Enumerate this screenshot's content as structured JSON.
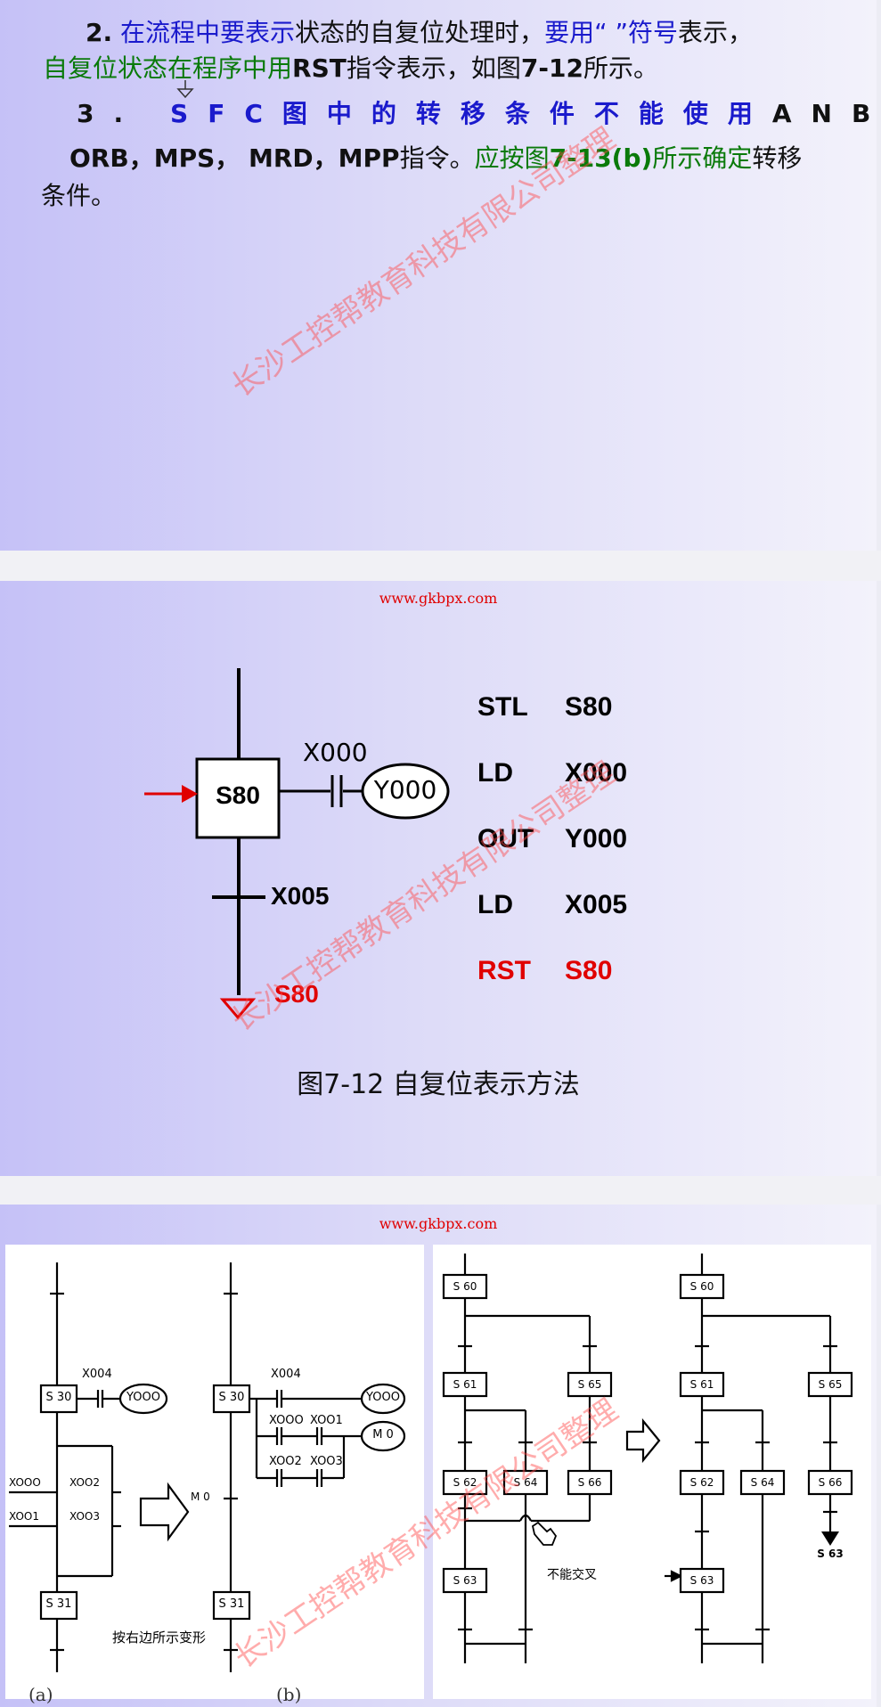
{
  "slide1": {
    "item2_num": "2.",
    "item2_a": "在流程中要表示",
    "item2_b": "状态的自复位处理时，",
    "item2_c": "要用“  ”符号",
    "item2_d": "表示，",
    "item2_e": "自复位状态在程序中用",
    "item2_f": "RST",
    "item2_g": "指令表示，如图",
    "item2_h": "7-12",
    "item2_i": "所示。",
    "item3_num": "3.",
    "item3_a": "SFC图中的转移条件不能使用",
    "item3_b": "ANB，",
    "item3_c": "ORB，MPS，  MRD，MPP",
    "item3_d": "指令。",
    "item3_e": "应按图",
    "item3_f": "7-13(b)",
    "item3_g": "所示确定",
    "item3_h": "转移",
    "item3_i": "条件。"
  },
  "watermark": "长沙工控帮教育科技有限公司整理",
  "url": "www.gkbpx.com",
  "slide2": {
    "step": "S80",
    "contact1": "X000",
    "coil": "Y000",
    "contact2": "X005",
    "reset_target": "S80",
    "caption": "图7-12 自复位表示方法",
    "program": [
      {
        "op": "STL",
        "arg": "S80"
      },
      {
        "op": "LD",
        "arg": "X000"
      },
      {
        "op": "OUT",
        "arg": "Y000"
      },
      {
        "op": "LD",
        "arg": "X005"
      },
      {
        "op": "RST",
        "arg": "S80"
      }
    ]
  },
  "slide3": {
    "a": {
      "s1": "S 30",
      "s2": "S 31",
      "x4": "X004",
      "y": "YOOO",
      "x0": "XOOO",
      "x1": "XOO1",
      "x2": "XOO2",
      "x3": "XOO3"
    },
    "b": {
      "s1": "S 30",
      "s2": "S 31",
      "x4": "X004",
      "y": "YOOO",
      "x0": "XOOO",
      "x1": "XOO1",
      "x2": "XOO2",
      "x3": "XOO3",
      "m": "M 0",
      "mcoil": "M 0"
    },
    "arrow_text": "按右边所示变形",
    "label_a": "(a)",
    "label_b": "(b)",
    "left_steps": {
      "s60": "S 60",
      "s61": "S 61",
      "s65": "S 65",
      "s62": "S 62",
      "s64": "S 64",
      "s66": "S 66",
      "s63": "S 63"
    },
    "right_steps": {
      "s60": "S 60",
      "s61": "S 61",
      "s65": "S 65",
      "s62": "S 62",
      "s64": "S 64",
      "s66": "S 66",
      "s63": "S 63",
      "jump": "S 63"
    },
    "cross_text": "不能交叉"
  }
}
